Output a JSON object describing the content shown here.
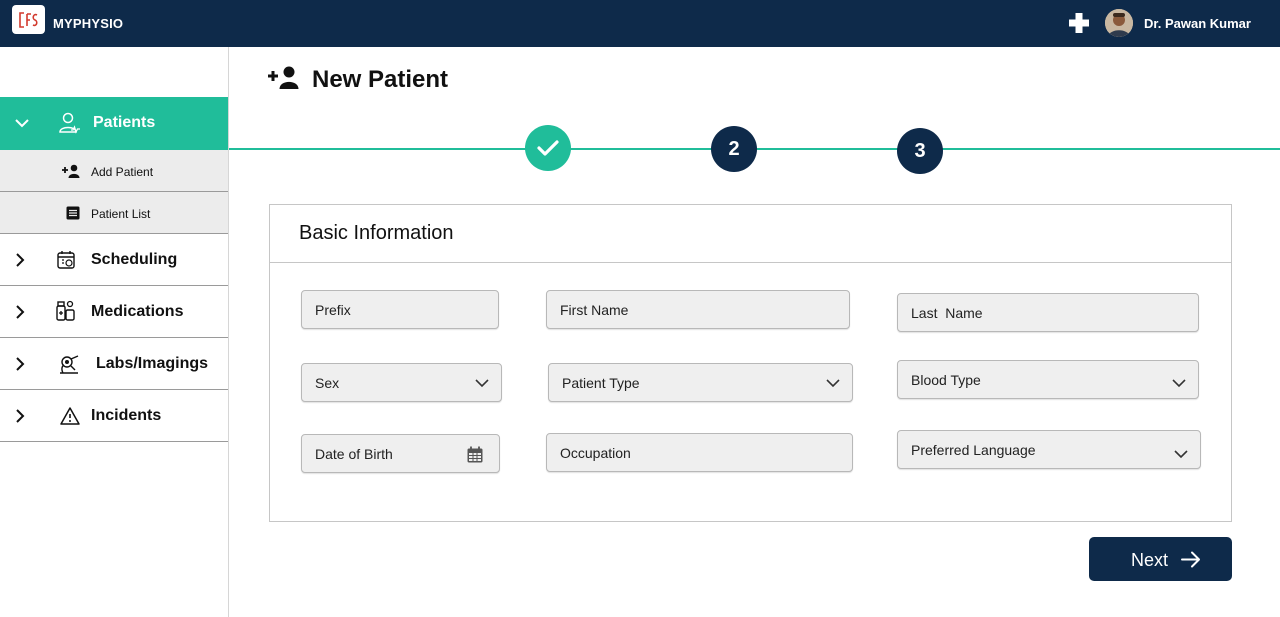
{
  "app": {
    "title": "MYPHYSIO",
    "logo_text": "ℂ"
  },
  "header": {
    "user_name": "Dr. Pawan Kumar"
  },
  "sidebar": {
    "active": {
      "label": "Patients"
    },
    "subitems": [
      {
        "label": "Add Patient",
        "icon": "add-user-icon"
      },
      {
        "label": "Patient List",
        "icon": "list-icon"
      }
    ],
    "items": [
      {
        "label": "Scheduling",
        "icon": "calendar-icon"
      },
      {
        "label": "Medications",
        "icon": "medication-icon"
      },
      {
        "label": "Labs/Imagings",
        "icon": "microscope-icon"
      },
      {
        "label": "Incidents",
        "icon": "warning-icon"
      }
    ]
  },
  "page": {
    "title": "New Patient"
  },
  "stepper": {
    "steps": [
      "done",
      "2",
      "3"
    ],
    "current_step": 2
  },
  "form": {
    "section_title": "Basic Information",
    "fields": {
      "prefix": "Prefix",
      "first_name": "First Name",
      "last_name": "Last  Name",
      "sex": "Sex",
      "patient_type": "Patient Type",
      "blood_type": "Blood Type",
      "dob": "Date of Birth",
      "occupation": "Occupation",
      "language": "Preferred Language"
    }
  },
  "actions": {
    "next_label": "Next"
  },
  "colors": {
    "navy": "#0e2a4a",
    "teal": "#20bd9a",
    "field_bg": "#efefef"
  }
}
